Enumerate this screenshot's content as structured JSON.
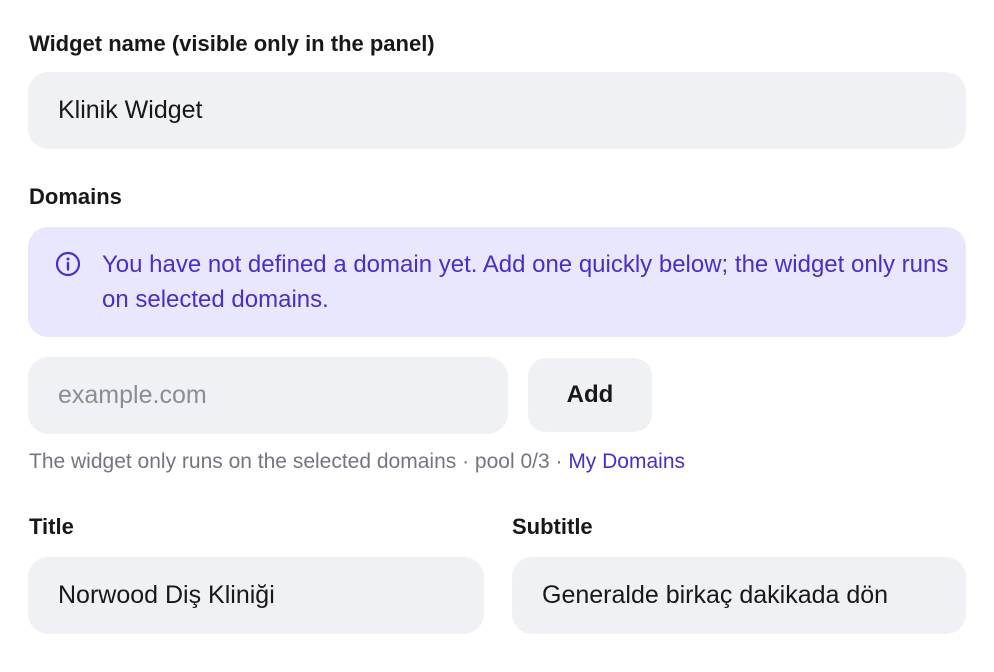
{
  "widget_name": {
    "label": "Widget name (visible only in the panel)",
    "value": "Klinik Widget"
  },
  "domains": {
    "label": "Domains",
    "notice": "You have not defined a domain yet. Add one quickly below; the widget only runs on selected domains.",
    "notice_icon": "info-icon",
    "input_placeholder": "example.com",
    "add_label": "Add",
    "hint_text": "The widget only runs on the selected domains · pool 0/3 · ",
    "hint_link": "My Domains"
  },
  "title": {
    "label": "Title",
    "value": "Norwood Diş Kliniği"
  },
  "subtitle": {
    "label": "Subtitle",
    "value": "Generalde birkaç dakikada dön"
  },
  "colors": {
    "input_bg": "#f0f1f4",
    "notice_bg": "#e9e7fe",
    "accent": "#4a2fc2"
  }
}
